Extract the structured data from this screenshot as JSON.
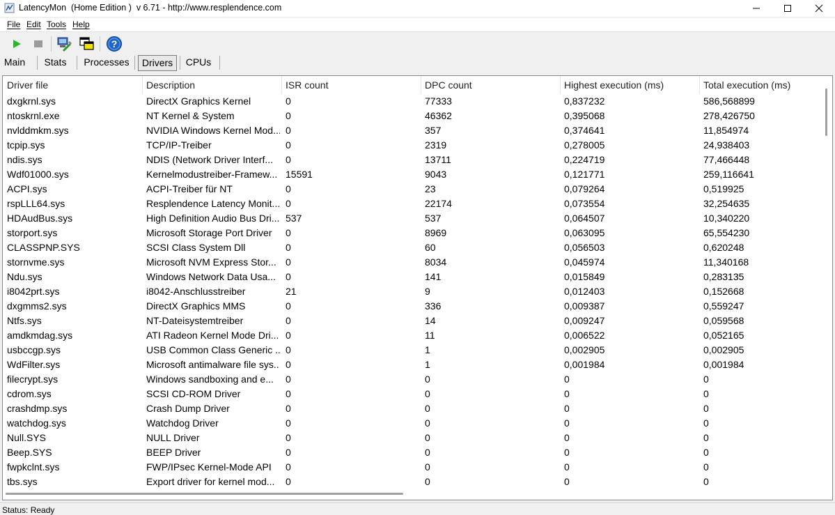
{
  "window": {
    "title": "LatencyMon  (Home Edition )  v 6.71 - http://www.resplendence.com"
  },
  "menu": [
    "File",
    "Edit",
    "Tools",
    "Help"
  ],
  "tabs": [
    {
      "label": "Main",
      "active": false
    },
    {
      "label": "Stats",
      "active": false
    },
    {
      "label": "Processes",
      "active": false
    },
    {
      "label": "Drivers",
      "active": true
    },
    {
      "label": "CPUs",
      "active": false
    }
  ],
  "table": {
    "columns": [
      "Driver file",
      "Description",
      "ISR count",
      "DPC count",
      "Highest execution (ms)",
      "Total execution (ms)"
    ],
    "rows": [
      [
        "dxgkrnl.sys",
        "DirectX Graphics Kernel",
        "0",
        "77333",
        "0,837232",
        "586,568899"
      ],
      [
        "ntoskrnl.exe",
        "NT Kernel & System",
        "0",
        "46362",
        "0,395068",
        "278,426750"
      ],
      [
        "nvlddmkm.sys",
        "NVIDIA Windows Kernel Mod...",
        "0",
        "357",
        "0,374641",
        "11,854974"
      ],
      [
        "tcpip.sys",
        "TCP/IP-Treiber",
        "0",
        "2319",
        "0,278005",
        "24,938403"
      ],
      [
        "ndis.sys",
        "NDIS (Network Driver Interf...",
        "0",
        "13711",
        "0,224719",
        "77,466448"
      ],
      [
        "Wdf01000.sys",
        "Kernelmodustreiber-Framew...",
        "15591",
        "9043",
        "0,121771",
        "259,116641"
      ],
      [
        "ACPI.sys",
        "ACPI-Treiber für NT",
        "0",
        "23",
        "0,079264",
        "0,519925"
      ],
      [
        "rspLLL64.sys",
        "Resplendence Latency Monit...",
        "0",
        "22174",
        "0,073554",
        "32,254635"
      ],
      [
        "HDAudBus.sys",
        "High Definition Audio Bus Dri...",
        "537",
        "537",
        "0,064507",
        "10,340220"
      ],
      [
        "storport.sys",
        "Microsoft Storage Port Driver",
        "0",
        "8969",
        "0,063095",
        "65,554230"
      ],
      [
        "CLASSPNP.SYS",
        "SCSI Class System Dll",
        "0",
        "60",
        "0,056503",
        "0,620248"
      ],
      [
        "stornvme.sys",
        "Microsoft NVM Express Stor...",
        "0",
        "8034",
        "0,045974",
        "11,340168"
      ],
      [
        "Ndu.sys",
        "Windows Network Data Usa...",
        "0",
        "141",
        "0,015849",
        "0,283135"
      ],
      [
        "i8042prt.sys",
        "i8042-Anschlusstreiber",
        "21",
        "9",
        "0,012403",
        "0,152668"
      ],
      [
        "dxgmms2.sys",
        "DirectX Graphics MMS",
        "0",
        "336",
        "0,009387",
        "0,559247"
      ],
      [
        "Ntfs.sys",
        "NT-Dateisystemtreiber",
        "0",
        "14",
        "0,009247",
        "0,059568"
      ],
      [
        "amdkmdag.sys",
        "ATI Radeon Kernel Mode Dri...",
        "0",
        "11",
        "0,006522",
        "0,052165"
      ],
      [
        "usbccgp.sys",
        "USB Common Class Generic ...",
        "0",
        "1",
        "0,002905",
        "0,002905"
      ],
      [
        "WdFilter.sys",
        "Microsoft antimalware file sys...",
        "0",
        "1",
        "0,001984",
        "0,001984"
      ],
      [
        "filecrypt.sys",
        "Windows sandboxing and e...",
        "0",
        "0",
        "0",
        "0"
      ],
      [
        "cdrom.sys",
        "SCSI CD-ROM Driver",
        "0",
        "0",
        "0",
        "0"
      ],
      [
        "crashdmp.sys",
        "Crash Dump Driver",
        "0",
        "0",
        "0",
        "0"
      ],
      [
        "watchdog.sys",
        "Watchdog Driver",
        "0",
        "0",
        "0",
        "0"
      ],
      [
        "Null.SYS",
        "NULL Driver",
        "0",
        "0",
        "0",
        "0"
      ],
      [
        "Beep.SYS",
        "BEEP Driver",
        "0",
        "0",
        "0",
        "0"
      ],
      [
        "fwpkclnt.sys",
        "FWP/IPsec Kernel-Mode API",
        "0",
        "0",
        "0",
        "0"
      ],
      [
        "tbs.sys",
        "Export driver for kernel mod...",
        "0",
        "0",
        "0",
        "0"
      ]
    ]
  },
  "status": "Status: Ready",
  "colors": {
    "play": "#2db52d",
    "help": "#1e63c8"
  }
}
